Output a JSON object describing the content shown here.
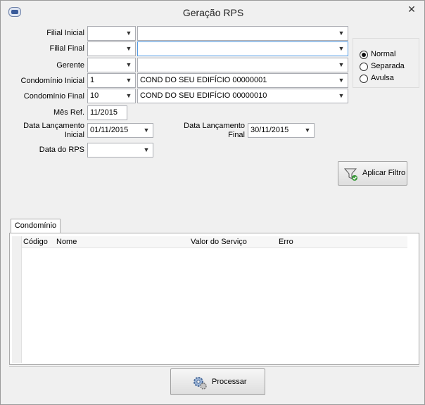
{
  "window": {
    "title": "Geração RPS",
    "close_glyph": "✕"
  },
  "labels": {
    "filial_inicial": "Filial Inicial",
    "filial_final": "Filial Final",
    "gerente": "Gerente",
    "condominio_inicial": "Condomínio Inicial",
    "condominio_final": "Condomínio Final",
    "mes_ref": "Mês Ref.",
    "data_lanc_inicial_1": "Data Lançamento",
    "data_lanc_inicial_2": "Inicial",
    "data_lanc_final_1": "Data Lançamento",
    "data_lanc_final_2": "Final",
    "data_rps": "Data do RPS"
  },
  "fields": {
    "filial_inicial_code": "",
    "filial_inicial_name": "",
    "filial_final_code": "",
    "filial_final_name": "",
    "gerente_code": "",
    "gerente_name": "",
    "condominio_inicial_code": "1",
    "condominio_inicial_name": "COND DO SEU EDIFÍCIO 00000001",
    "condominio_final_code": "10",
    "condominio_final_name": "COND DO SEU EDIFÍCIO 00000010",
    "mes_ref": "11/2015",
    "data_lanc_inicial": "01/11/2015",
    "data_lanc_final": "30/11/2015",
    "data_rps": ""
  },
  "rps_type": {
    "options": [
      "Normal",
      "Separada",
      "Avulsa"
    ],
    "selected": "Normal"
  },
  "buttons": {
    "aplicar_filtro": "Aplicar Filtro",
    "processar": "Processar"
  },
  "tabs": [
    {
      "label": "Condomínio",
      "active": true
    }
  ],
  "grid": {
    "columns": [
      "Código",
      "Nome",
      "Valor do Serviço",
      "Erro"
    ],
    "rows": []
  },
  "icons": {
    "app": "app-icon",
    "close": "close-icon",
    "dropdown": "chevron-down-icon",
    "filter": "filter-icon",
    "process": "gear-icon"
  },
  "colors": {
    "window_bg": "#f0f0f0",
    "focus_border": "#569de5"
  }
}
